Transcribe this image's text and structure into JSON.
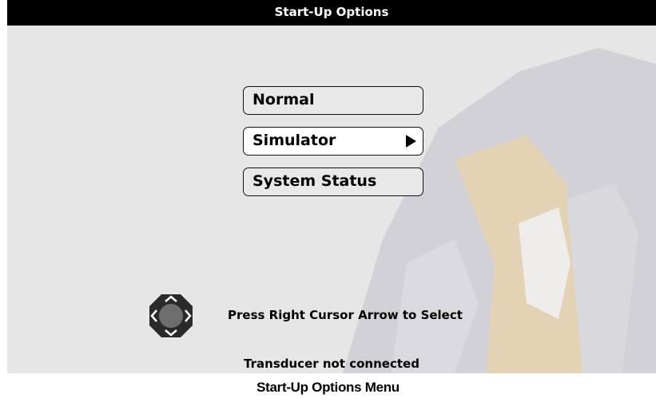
{
  "screen": {
    "title": "Start-Up Options",
    "menu": [
      {
        "label": "Normal",
        "selected": false
      },
      {
        "label": "Simulator",
        "selected": true
      },
      {
        "label": "System Status",
        "selected": false
      }
    ],
    "cursor_pad_icon": "four-way-cursor-pad-icon",
    "instruction": "Press Right Cursor Arrow to Select",
    "status": "Transducer not connected"
  },
  "caption": "Start-Up Options Menu",
  "colors": {
    "titlebar": "#000000",
    "screen_background": "#e6e6e6",
    "selected_button": "#ffffff",
    "watermark_gray": "#c8c8d0",
    "watermark_tan": "#e8cfa8"
  }
}
